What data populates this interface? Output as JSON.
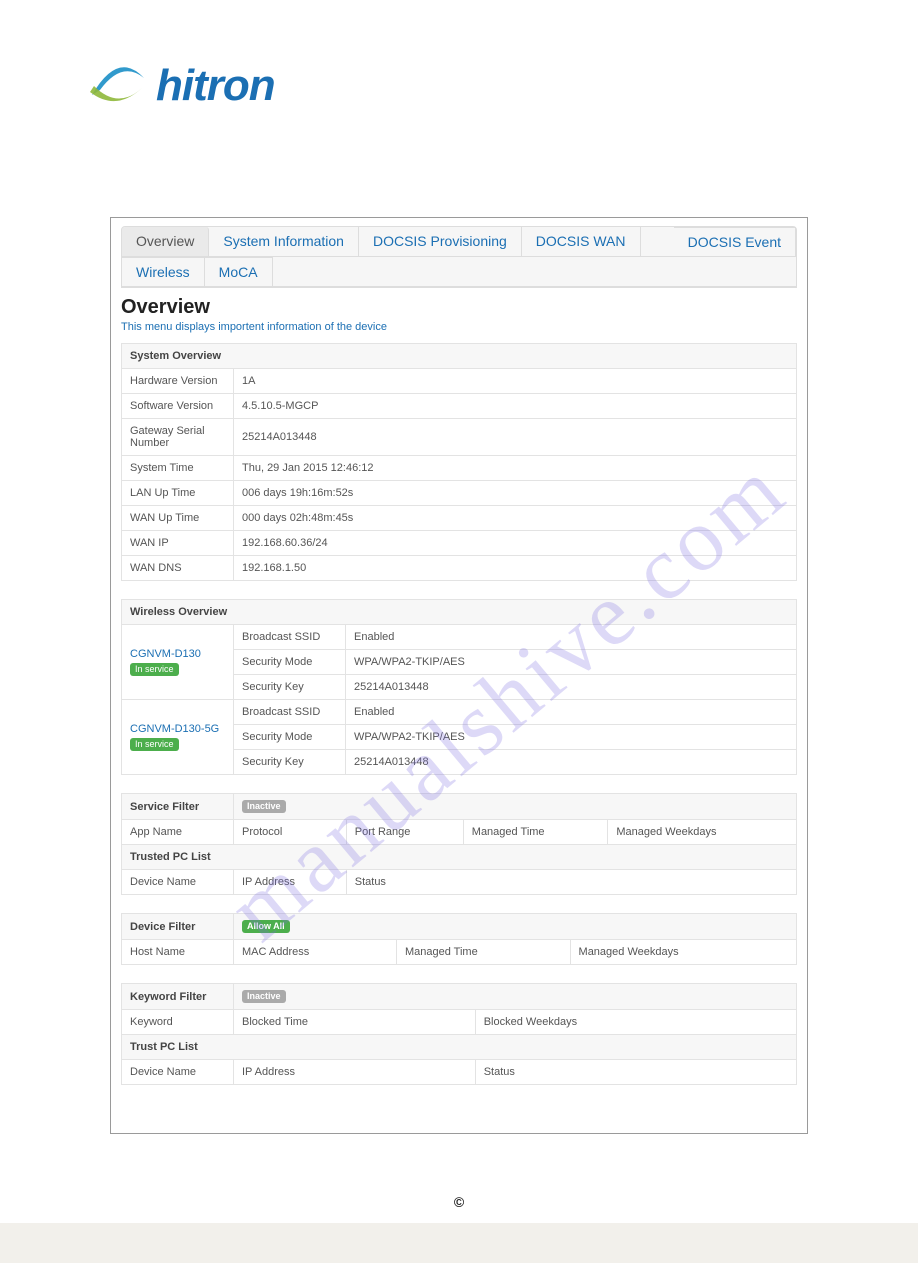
{
  "logo": {
    "text": "hitron"
  },
  "tabs": [
    "Overview",
    "System Information",
    "DOCSIS Provisioning",
    "DOCSIS WAN",
    "DOCSIS Event",
    "Wireless",
    "MoCA"
  ],
  "active_tab_index": 0,
  "heading": "Overview",
  "subdesc": "This menu displays importent information of the device",
  "system_overview": {
    "title": "System Overview",
    "rows": [
      {
        "label": "Hardware Version",
        "value": "1A"
      },
      {
        "label": "Software Version",
        "value": "4.5.10.5-MGCP"
      },
      {
        "label": "Gateway Serial Number",
        "value": "25214A013448"
      },
      {
        "label": "System Time",
        "value": "Thu, 29 Jan 2015 12:46:12"
      },
      {
        "label": "LAN Up Time",
        "value": "006 days 19h:16m:52s"
      },
      {
        "label": "WAN Up Time",
        "value": "000 days 02h:48m:45s"
      },
      {
        "label": "WAN IP",
        "value": "192.168.60.36/24"
      },
      {
        "label": "WAN DNS",
        "value": "192.168.1.50"
      }
    ]
  },
  "wireless_overview": {
    "title": "Wireless Overview",
    "badge_service": "In service",
    "networks": [
      {
        "ssid": "CGNVM-D130",
        "rows": [
          {
            "label": "Broadcast SSID",
            "value": "Enabled"
          },
          {
            "label": "Security Mode",
            "value": "WPA/WPA2-TKIP/AES"
          },
          {
            "label": "Security Key",
            "value": "25214A013448"
          }
        ]
      },
      {
        "ssid": "CGNVM-D130-5G",
        "rows": [
          {
            "label": "Broadcast SSID",
            "value": "Enabled"
          },
          {
            "label": "Security Mode",
            "value": "WPA/WPA2-TKIP/AES"
          },
          {
            "label": "Security Key",
            "value": "25214A013448"
          }
        ]
      }
    ]
  },
  "service_filter": {
    "title": "Service Filter",
    "badge": "Inactive",
    "headers": [
      "App Name",
      "Protocol",
      "Port Range",
      "Managed Time",
      "Managed Weekdays"
    ],
    "trusted_title": "Trusted PC List",
    "trusted_headers": [
      "Device Name",
      "IP Address",
      "Status"
    ]
  },
  "device_filter": {
    "title": "Device Filter",
    "badge": "Allow All",
    "headers": [
      "Host Name",
      "MAC Address",
      "Managed Time",
      "Managed Weekdays"
    ]
  },
  "keyword_filter": {
    "title": "Keyword Filter",
    "badge": "Inactive",
    "headers": [
      "Keyword",
      "Blocked Time",
      "Blocked Weekdays"
    ],
    "trusted_title": "Trust PC List",
    "trusted_headers": [
      "Device Name",
      "IP Address",
      "Status"
    ]
  },
  "watermark": "manualshive.com",
  "copyright": "©"
}
